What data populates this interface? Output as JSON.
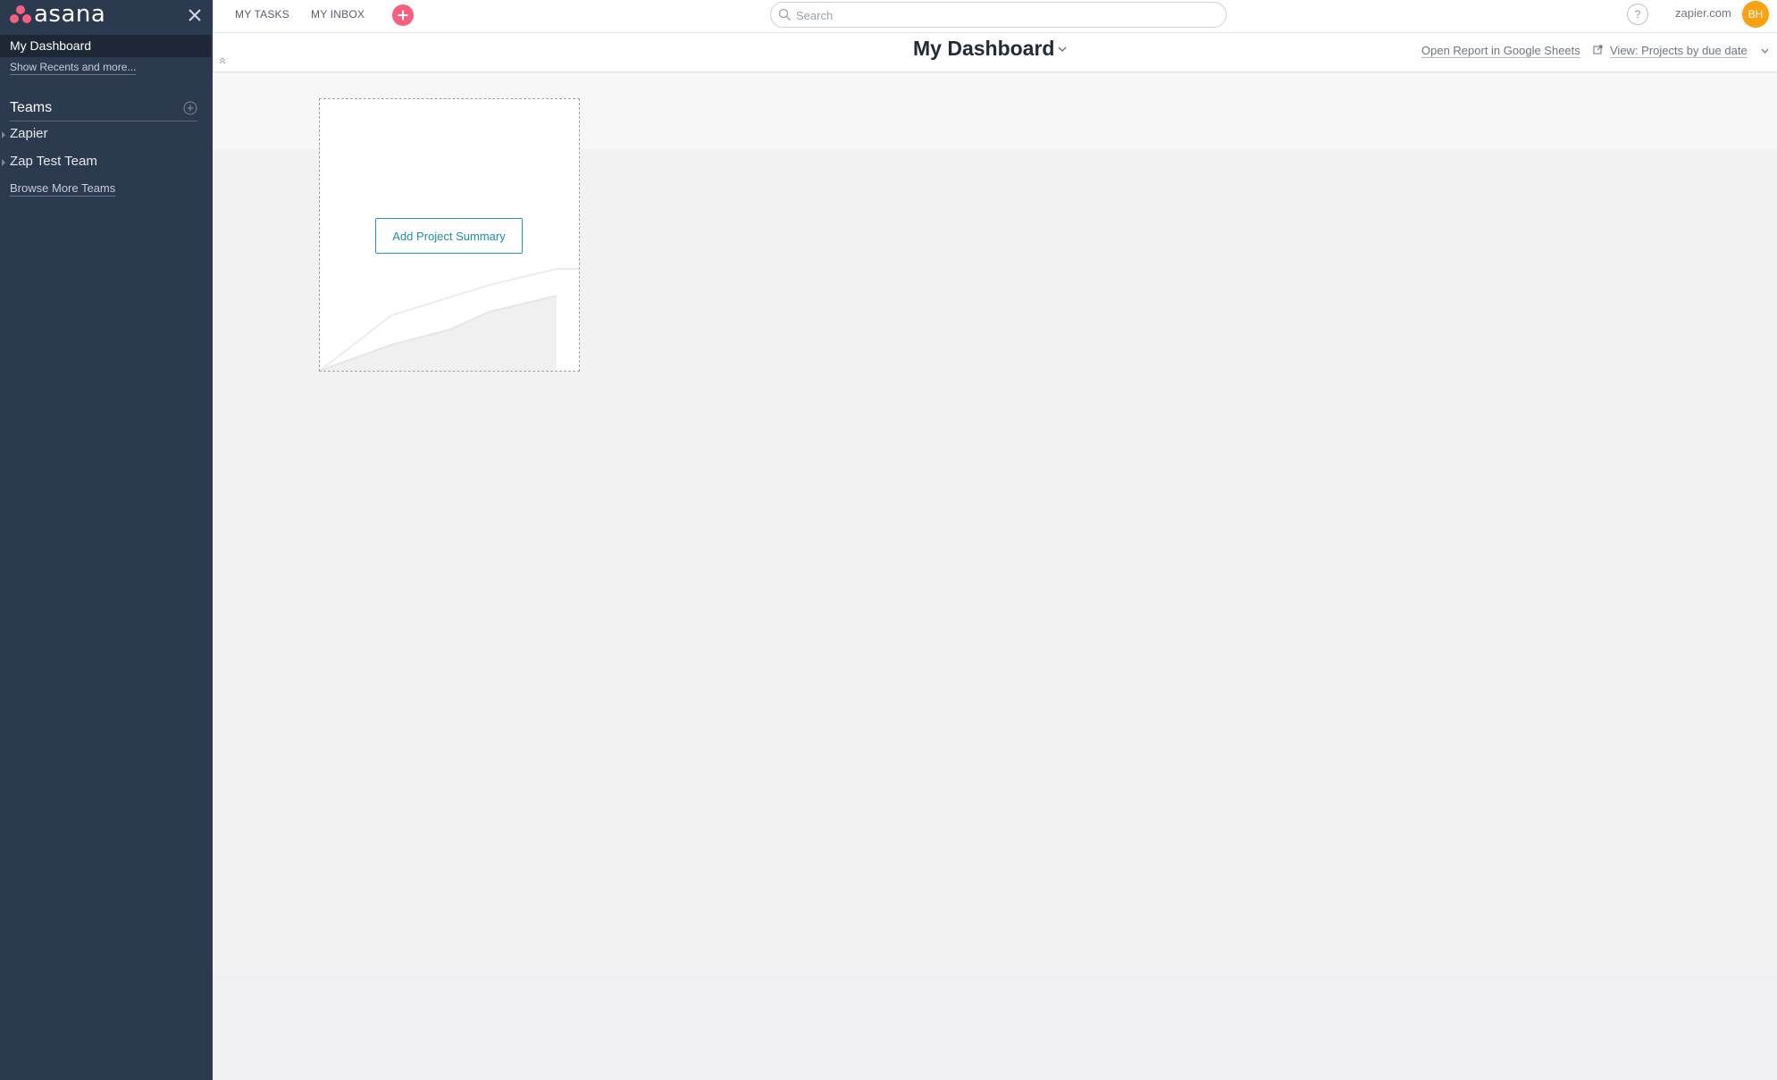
{
  "sidebar": {
    "logo_text": "asana",
    "dashboard_label": "My Dashboard",
    "recents_link": "Show Recents and more...",
    "teams_header": "Teams",
    "teams": [
      {
        "label": "Zapier"
      },
      {
        "label": "Zap Test Team"
      }
    ],
    "browse_link": "Browse More Teams"
  },
  "topbar": {
    "my_tasks": "MY TASKS",
    "my_inbox": "MY INBOX",
    "search_placeholder": "Search",
    "help_label": "?",
    "org_name": "zapier.com",
    "avatar_initials": "BH"
  },
  "header": {
    "title": "My Dashboard",
    "sheets_link": "Open Report in Google Sheets",
    "view_selector": "View: Projects by due date"
  },
  "card": {
    "button_label": "Add Project Summary"
  },
  "colors": {
    "sidebar_bg": "#2c3a4f",
    "sidebar_selected": "#1d2735",
    "add_button": "#f95f7f",
    "avatar": "#f9a10e",
    "accent": "#1c8fa6"
  }
}
